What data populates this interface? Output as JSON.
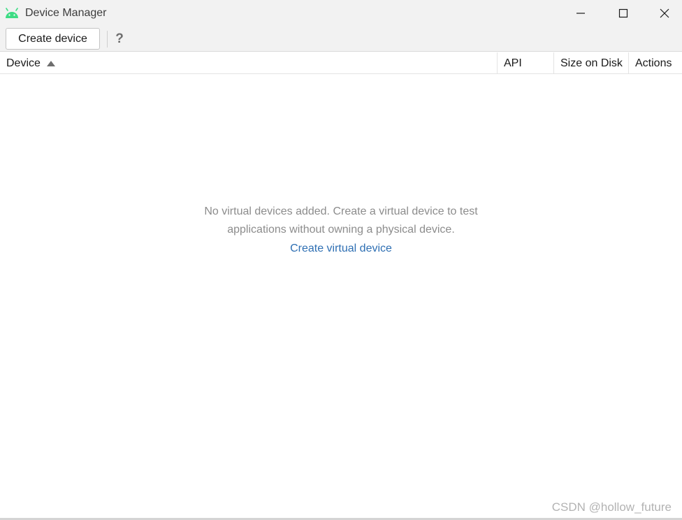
{
  "window": {
    "title": "Device Manager",
    "app_icon": "android-icon",
    "controls": {
      "minimize": "minimize-icon",
      "maximize": "maximize-icon",
      "close": "close-icon"
    }
  },
  "toolbar": {
    "create_label": "Create device",
    "help_label": "?"
  },
  "table": {
    "columns": [
      "Device",
      "API",
      "Size on Disk",
      "Actions"
    ],
    "sorted_column": "Device",
    "sort_direction": "ascending",
    "rows": []
  },
  "empty_state": {
    "message": "No virtual devices added. Create a virtual device to test applications without owning a physical device.",
    "link_label": "Create virtual device"
  },
  "watermark": "CSDN @hollow_future",
  "colors": {
    "android_green": "#3ddc84",
    "link_blue": "#2e6fb3",
    "muted_text": "#8c8c8c"
  }
}
